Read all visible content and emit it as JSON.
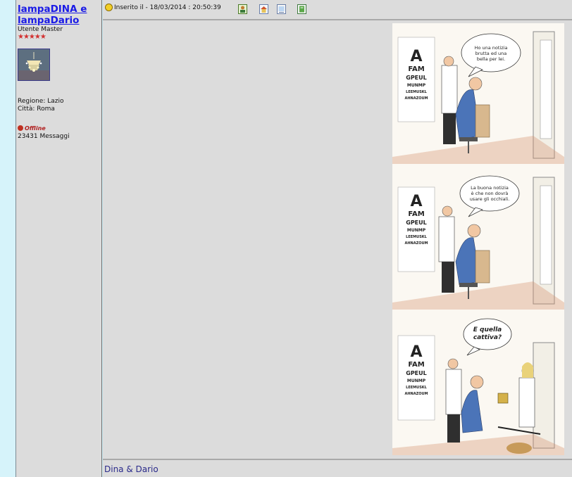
{
  "user": {
    "name": "lampaDINA e lampaDario",
    "rank": "Utente Master",
    "stars": "★★★★★",
    "region": "Regione: Lazio",
    "city": "Città: Roma",
    "status": "Offline",
    "messages": "23431 Messaggi"
  },
  "post": {
    "date_label": "Inserito il - 18/03/2014 : 20:50:39",
    "toolbar_icons": [
      "profile-icon",
      "home-icon",
      "quote-icon",
      "edit-icon"
    ],
    "signature": "Dina & Dario"
  },
  "comic": {
    "panel1": {
      "bubble": [
        "Ho una notizia",
        "brutta ed una",
        "bella per lei."
      ]
    },
    "panel2": {
      "bubble": [
        "La buona notizia",
        "è che non dovrà",
        "usare gli occhiali."
      ]
    },
    "panel3": {
      "bubble": [
        "E quella",
        "cattiva?"
      ]
    },
    "chart_rows": [
      "A",
      "FAM",
      "GPEUL",
      "MUNMP",
      "LEEMUSKL",
      "AHNAZOUM"
    ]
  },
  "colors": {
    "link": "#1a1ae6",
    "stars": "#d23030",
    "panel_bg": "#dcdcdc",
    "left_bg": "#d6f3fa"
  }
}
